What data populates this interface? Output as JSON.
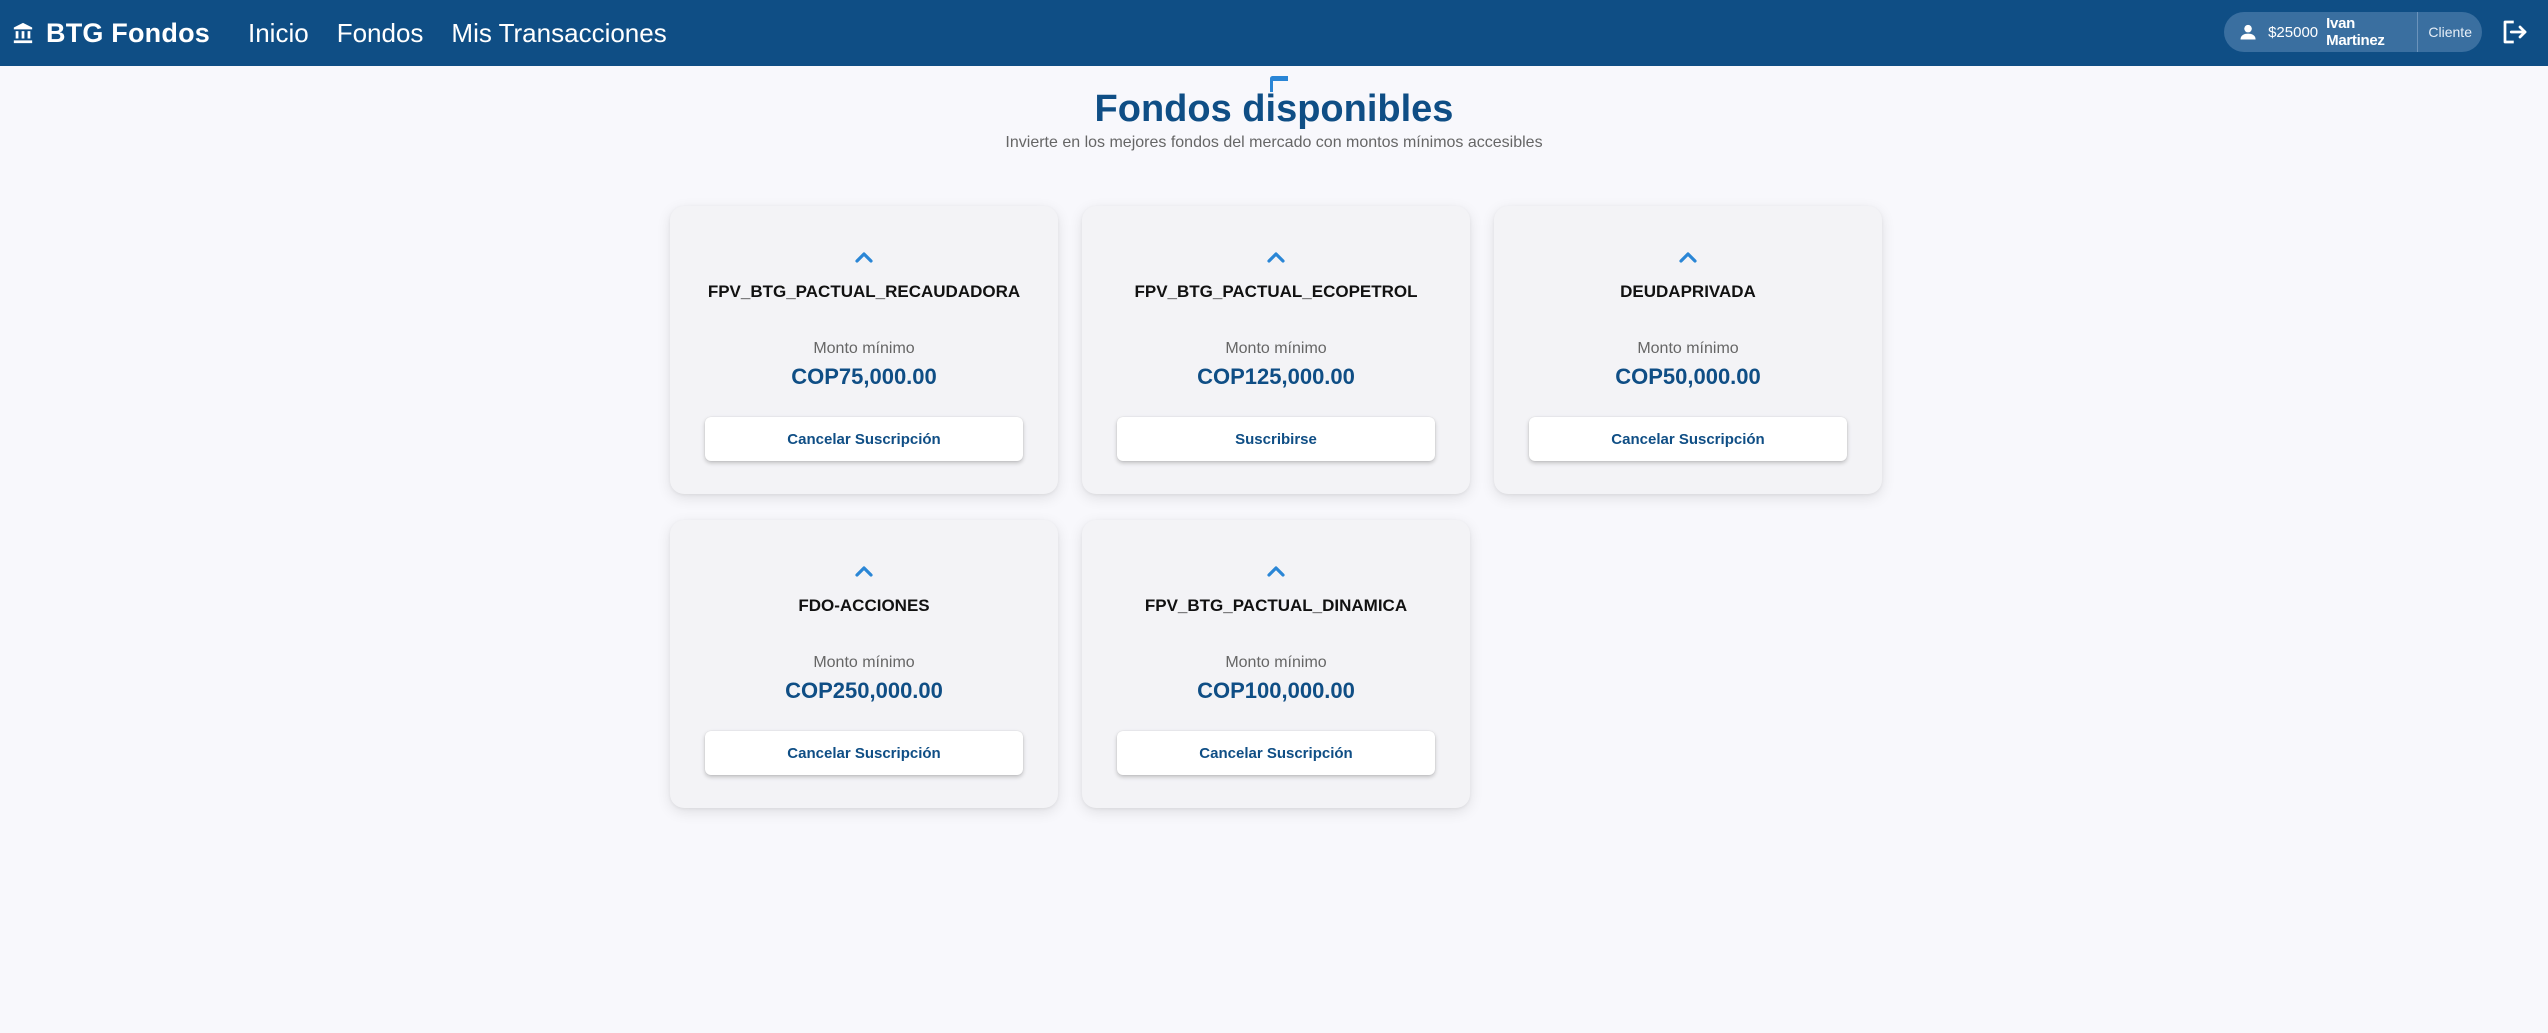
{
  "app": {
    "brand": "BTG Fondos"
  },
  "nav": {
    "items": [
      {
        "label": "Inicio"
      },
      {
        "label": "Fondos"
      },
      {
        "label": "Mis Transacciones"
      }
    ]
  },
  "user": {
    "balance": "$25000",
    "name": "Ivan Martinez",
    "role": "Cliente"
  },
  "page": {
    "title": "Fondos disponibles",
    "subtitle": "Invierte en los mejores fondos del mercado con montos mínimos accesibles"
  },
  "funds": [
    {
      "name": "FPV_BTG_PACTUAL_RECAUDADORA",
      "min_label": "Monto mínimo",
      "amount": "COP75,000.00",
      "action": "Cancelar Suscripción"
    },
    {
      "name": "FPV_BTG_PACTUAL_ECOPETROL",
      "min_label": "Monto mínimo",
      "amount": "COP125,000.00",
      "action": "Suscribirse"
    },
    {
      "name": "DEUDAPRIVADA",
      "min_label": "Monto mínimo",
      "amount": "COP50,000.00",
      "action": "Cancelar Suscripción"
    },
    {
      "name": "FDO-ACCIONES",
      "min_label": "Monto mínimo",
      "amount": "COP250,000.00",
      "action": "Cancelar Suscripción"
    },
    {
      "name": "FPV_BTG_PACTUAL_DINAMICA",
      "min_label": "Monto mínimo",
      "amount": "COP100,000.00",
      "action": "Cancelar Suscripción"
    }
  ],
  "icons": {
    "brand": "bank-icon",
    "user": "account-icon",
    "logout": "logout-icon",
    "card": "chevron-up-icon"
  },
  "colors": {
    "primary": "#0f4e85",
    "accent": "#2a86d6",
    "background": "#f8f8fc"
  }
}
